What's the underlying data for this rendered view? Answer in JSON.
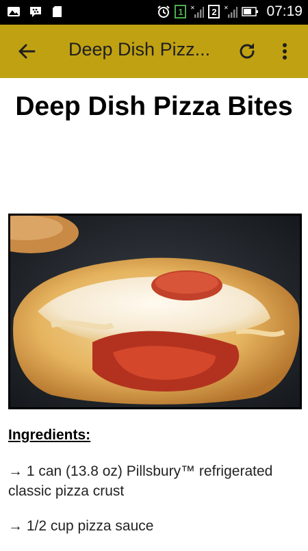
{
  "status_bar": {
    "time": "07:19",
    "sim1": "1",
    "sim2": "2",
    "icons": [
      "image-icon",
      "bbm-icon",
      "sd-card-icon",
      "alarm-icon",
      "sim1-icon",
      "signal-icon",
      "sim2-icon",
      "signal-icon",
      "battery-icon"
    ]
  },
  "app_bar": {
    "title": "Deep Dish Pizz...",
    "color": "#c0a112",
    "icons": [
      "back-arrow-icon",
      "refresh-icon",
      "more-vert-icon"
    ]
  },
  "recipe": {
    "title": "Deep Dish Pizza Bites",
    "ingredients_heading": "Ingredients:",
    "ingredients": [
      "→ 1 can (13.8 oz) Pillsbury™ refrigerated classic pizza crust",
      "→ 1/2 cup pizza sauce"
    ]
  }
}
